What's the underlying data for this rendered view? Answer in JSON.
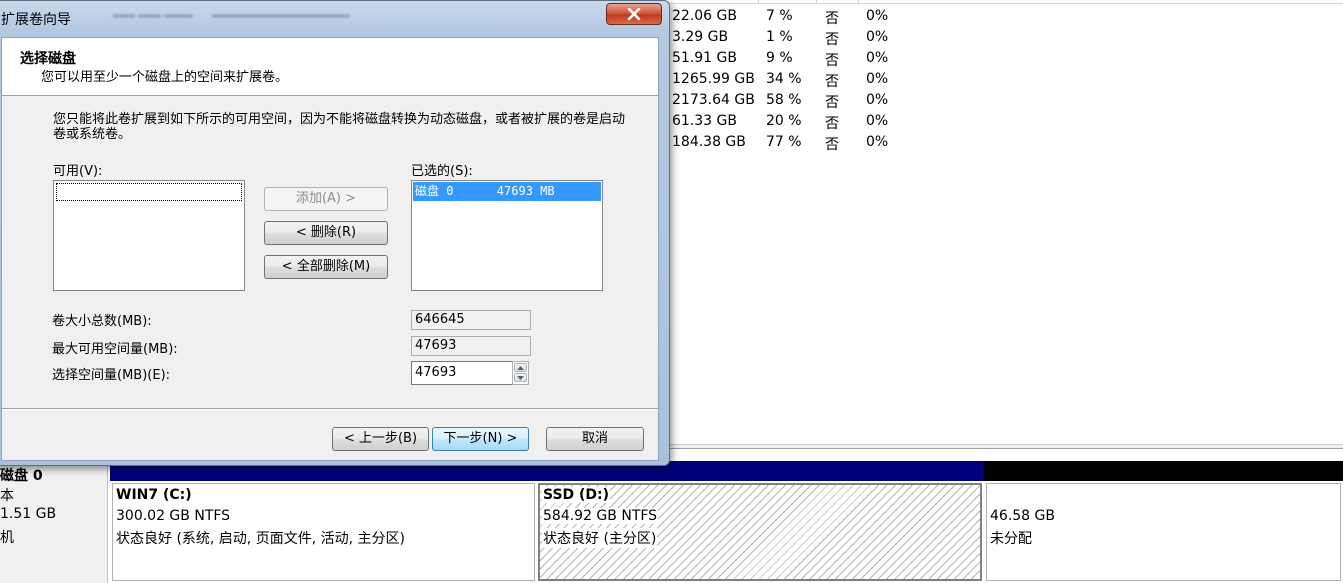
{
  "volume_list": {
    "rows": [
      {
        "free": "22.06 GB",
        "percent": "7 %",
        "fault_tolerance": "否",
        "overhead": "0%"
      },
      {
        "free": "3.29 GB",
        "percent": "1 %",
        "fault_tolerance": "否",
        "overhead": "0%"
      },
      {
        "free": "51.91 GB",
        "percent": "9 %",
        "fault_tolerance": "否",
        "overhead": "0%"
      },
      {
        "free": "1265.99 GB",
        "percent": "34 %",
        "fault_tolerance": "否",
        "overhead": "0%"
      },
      {
        "free": "2173.64 GB",
        "percent": "58 %",
        "fault_tolerance": "否",
        "overhead": "0%"
      },
      {
        "free": "61.33 GB",
        "percent": "20 %",
        "fault_tolerance": "否",
        "overhead": "0%"
      },
      {
        "free": "184.38 GB",
        "percent": "77 %",
        "fault_tolerance": "否",
        "overhead": "0%"
      }
    ]
  },
  "disk_map": {
    "disk": {
      "name": "磁盘 0",
      "type": "本",
      "size": "1.51 GB",
      "status": "机"
    },
    "partitions": [
      {
        "title": "WIN7  (C:)",
        "size": "300.02 GB NTFS",
        "status": "状态良好 (系统, 启动, 页面文件, 活动, 主分区)",
        "bar_color": "#00007c"
      },
      {
        "title": "SSD  (D:)",
        "size": "584.92 GB NTFS",
        "status": "状态良好 (主分区)",
        "bar_color": "#00007c"
      },
      {
        "title": "",
        "size": "46.58 GB",
        "status": "未分配",
        "bar_color": "#000000"
      }
    ]
  },
  "wizard": {
    "title": "扩展卷向导",
    "header_title": "选择磁盘",
    "header_subtitle": "您可以用至少一个磁盘上的空间来扩展卷。",
    "description": "您只能将此卷扩展到如下所示的可用空间，因为不能将磁盘转换为动态磁盘，或者被扩展的卷是启动卷或系统卷。",
    "available_label": "可用(V):",
    "selected_label": "已选的(S):",
    "selected_items": [
      "磁盘 0      47693 MB"
    ],
    "add_button": "添加(A) >",
    "remove_button": "< 删除(R)",
    "remove_all_button": "< 全部删除(M)",
    "total_size_label": "卷大小总数(MB):",
    "total_size_value": "646645",
    "max_space_label": "最大可用空间量(MB):",
    "max_space_value": "47693",
    "select_space_label": "选择空间量(MB)(E):",
    "select_space_value": "47693",
    "back_button": "< 上一步(B)",
    "next_button": "下一步(N) >",
    "cancel_button": "取消"
  }
}
